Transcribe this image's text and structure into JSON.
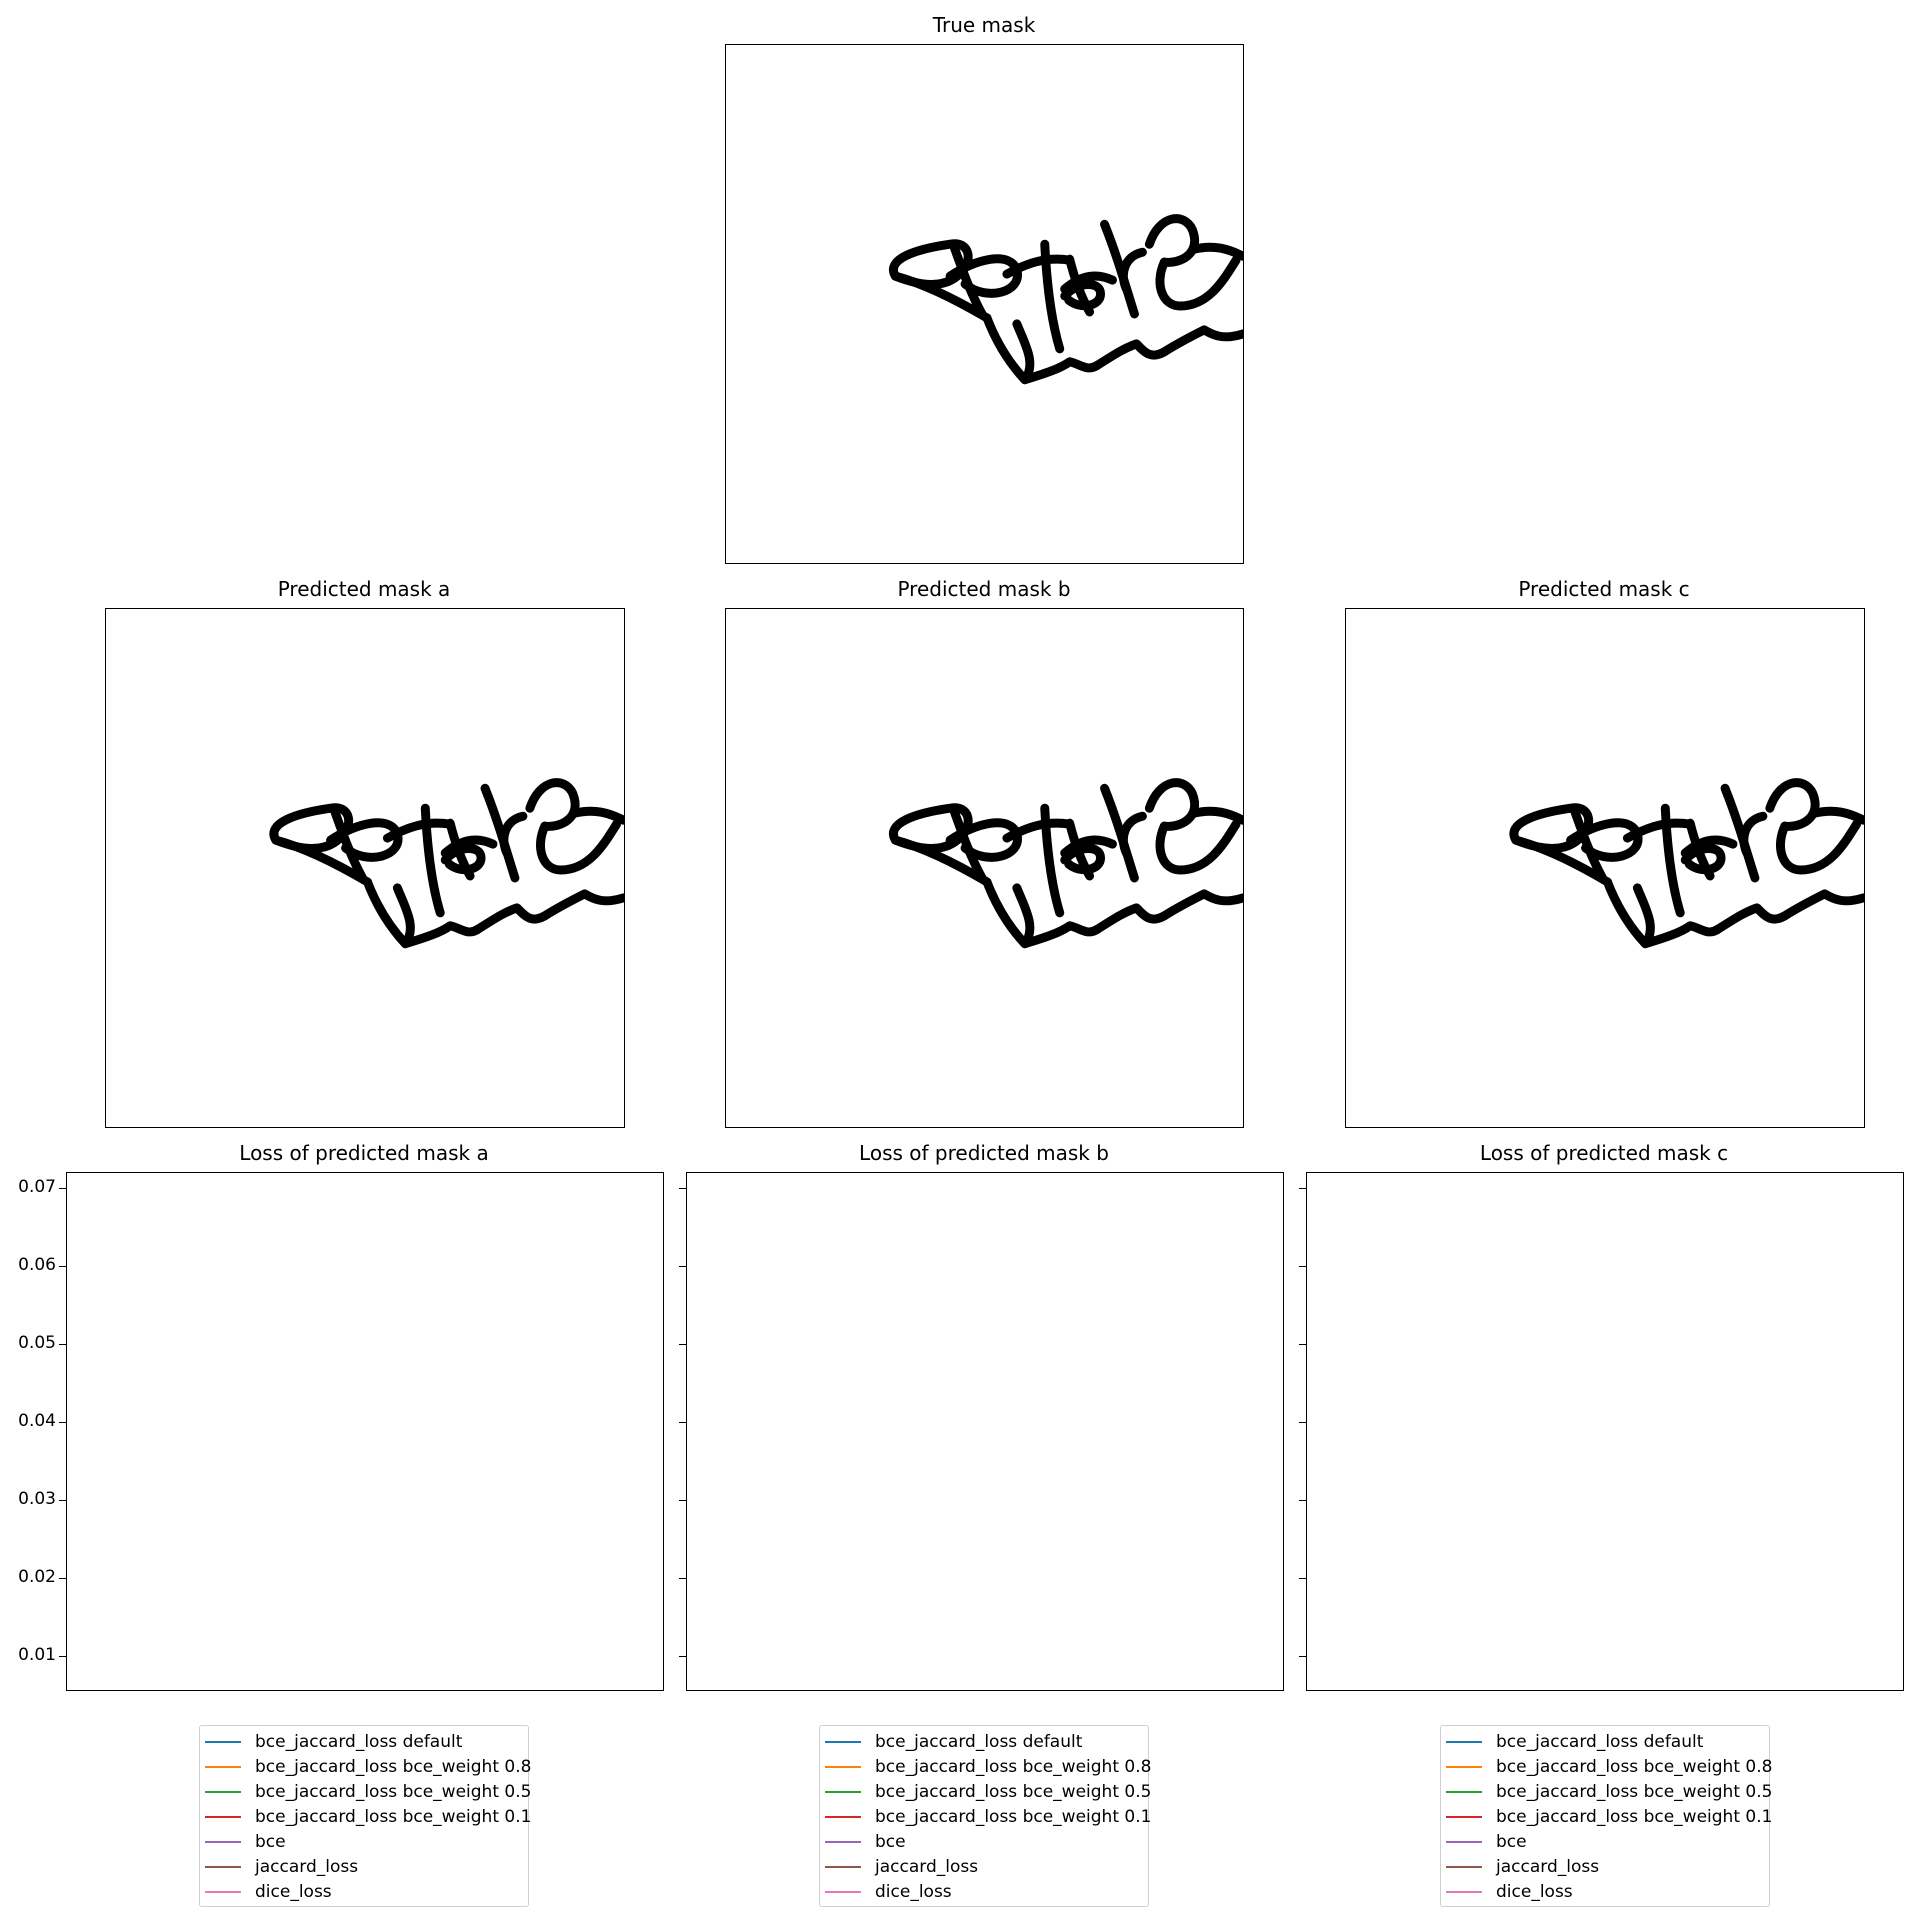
{
  "figure": {
    "true_mask": {
      "title": "True mask",
      "signature_text": "BEAS"
    },
    "predicted_masks": [
      {
        "title": "Predicted mask a",
        "signature_text": "BEAS"
      },
      {
        "title": "Predicted mask b",
        "signature_text": "BEAS"
      },
      {
        "title": "Predicted mask c",
        "signature_text": "BEAS"
      }
    ],
    "colors": {
      "mask_ink": "#000000",
      "axis": "#000000",
      "series": [
        "#1f77b4",
        "#ff7f0e",
        "#2ca02c",
        "#d62728",
        "#9467bd",
        "#8c564b",
        "#e377c2"
      ]
    }
  },
  "chart_data": [
    {
      "type": "line",
      "title": "Loss of predicted mask a",
      "ylim": [
        0.0055,
        0.072
      ],
      "yticks": [
        "0.01",
        "0.02",
        "0.03",
        "0.04",
        "0.05",
        "0.06",
        "0.07"
      ],
      "ytick_values": [
        0.01,
        0.02,
        0.03,
        0.04,
        0.05,
        0.06,
        0.07
      ],
      "show_ytick_labels": true,
      "grid": false,
      "legend_placement": "below",
      "series": [
        {
          "name": "bce_jaccard_loss default",
          "values": []
        },
        {
          "name": "bce_jaccard_loss bce_weight 0.8",
          "values": []
        },
        {
          "name": "bce_jaccard_loss bce_weight 0.5",
          "values": []
        },
        {
          "name": "bce_jaccard_loss bce_weight 0.1",
          "values": []
        },
        {
          "name": "bce",
          "values": []
        },
        {
          "name": "jaccard_loss",
          "values": []
        },
        {
          "name": "dice_loss",
          "values": []
        }
      ]
    },
    {
      "type": "line",
      "title": "Loss of predicted mask b",
      "ylim": [
        0.0055,
        0.072
      ],
      "yticks": [
        "0.01",
        "0.02",
        "0.03",
        "0.04",
        "0.05",
        "0.06",
        "0.07"
      ],
      "ytick_values": [
        0.01,
        0.02,
        0.03,
        0.04,
        0.05,
        0.06,
        0.07
      ],
      "show_ytick_labels": false,
      "grid": false,
      "legend_placement": "below",
      "series": [
        {
          "name": "bce_jaccard_loss default",
          "values": []
        },
        {
          "name": "bce_jaccard_loss bce_weight 0.8",
          "values": []
        },
        {
          "name": "bce_jaccard_loss bce_weight 0.5",
          "values": []
        },
        {
          "name": "bce_jaccard_loss bce_weight 0.1",
          "values": []
        },
        {
          "name": "bce",
          "values": []
        },
        {
          "name": "jaccard_loss",
          "values": []
        },
        {
          "name": "dice_loss",
          "values": []
        }
      ]
    },
    {
      "type": "line",
      "title": "Loss of predicted mask c",
      "ylim": [
        0.0055,
        0.072
      ],
      "yticks": [
        "0.01",
        "0.02",
        "0.03",
        "0.04",
        "0.05",
        "0.06",
        "0.07"
      ],
      "ytick_values": [
        0.01,
        0.02,
        0.03,
        0.04,
        0.05,
        0.06,
        0.07
      ],
      "show_ytick_labels": false,
      "grid": false,
      "legend_placement": "below",
      "series": [
        {
          "name": "bce_jaccard_loss default",
          "values": []
        },
        {
          "name": "bce_jaccard_loss bce_weight 0.8",
          "values": []
        },
        {
          "name": "bce_jaccard_loss bce_weight 0.5",
          "values": []
        },
        {
          "name": "bce_jaccard_loss bce_weight 0.1",
          "values": []
        },
        {
          "name": "bce",
          "values": []
        },
        {
          "name": "jaccard_loss",
          "values": []
        },
        {
          "name": "dice_loss",
          "values": []
        }
      ]
    }
  ]
}
